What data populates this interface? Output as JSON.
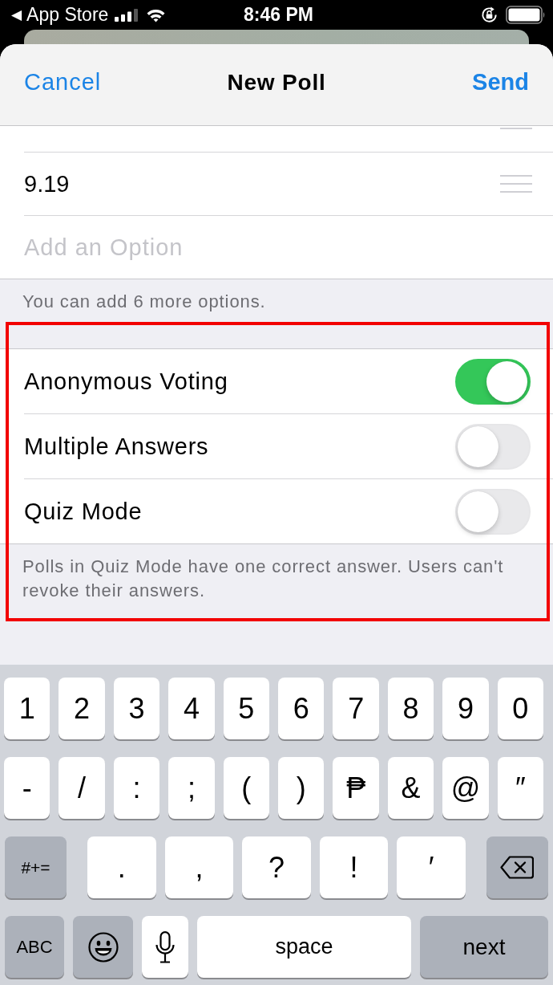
{
  "status_bar": {
    "back_glyph": "◀",
    "back_label": "App Store",
    "time": "8:46 PM"
  },
  "nav_bar": {
    "cancel": "Cancel",
    "title": "New Poll",
    "send": "Send"
  },
  "options": {
    "items": [
      {
        "text": "9.19"
      }
    ],
    "add_placeholder": "Add an Option",
    "note": "You can add 6 more options."
  },
  "settings": {
    "highlighted": true,
    "items": [
      {
        "label": "Anonymous Voting",
        "on": true
      },
      {
        "label": "Multiple Answers",
        "on": false
      },
      {
        "label": "Quiz Mode",
        "on": false
      }
    ],
    "note": "Polls in Quiz Mode have one correct answer. Users can't revoke their answers."
  },
  "keyboard": {
    "rows": [
      {
        "keys": [
          {
            "kind": "char",
            "label": "1"
          },
          {
            "kind": "char",
            "label": "2"
          },
          {
            "kind": "char",
            "label": "3"
          },
          {
            "kind": "char",
            "label": "4"
          },
          {
            "kind": "char",
            "label": "5"
          },
          {
            "kind": "char",
            "label": "6"
          },
          {
            "kind": "char",
            "label": "7"
          },
          {
            "kind": "char",
            "label": "8"
          },
          {
            "kind": "char",
            "label": "9"
          },
          {
            "kind": "char",
            "label": "0"
          }
        ]
      },
      {
        "keys": [
          {
            "kind": "char",
            "label": "-"
          },
          {
            "kind": "char",
            "label": "/"
          },
          {
            "kind": "char",
            "label": ":"
          },
          {
            "kind": "char",
            "label": ";"
          },
          {
            "kind": "char",
            "label": "("
          },
          {
            "kind": "char",
            "label": ")"
          },
          {
            "kind": "char",
            "label": "₱"
          },
          {
            "kind": "char",
            "label": "&"
          },
          {
            "kind": "char",
            "label": "@"
          },
          {
            "kind": "char",
            "label": "″"
          }
        ]
      },
      {
        "keys": [
          {
            "kind": "shift",
            "label": "#+="
          },
          {
            "kind": "char",
            "label": "."
          },
          {
            "kind": "char",
            "label": ","
          },
          {
            "kind": "char",
            "label": "?"
          },
          {
            "kind": "char",
            "label": "!"
          },
          {
            "kind": "char",
            "label": "′"
          },
          {
            "kind": "backspace"
          }
        ]
      },
      {
        "keys": [
          {
            "kind": "abc",
            "label": "ABC"
          },
          {
            "kind": "emoji"
          },
          {
            "kind": "mic"
          },
          {
            "kind": "space",
            "label": "space"
          },
          {
            "kind": "return",
            "label": "next"
          }
        ]
      }
    ]
  }
}
